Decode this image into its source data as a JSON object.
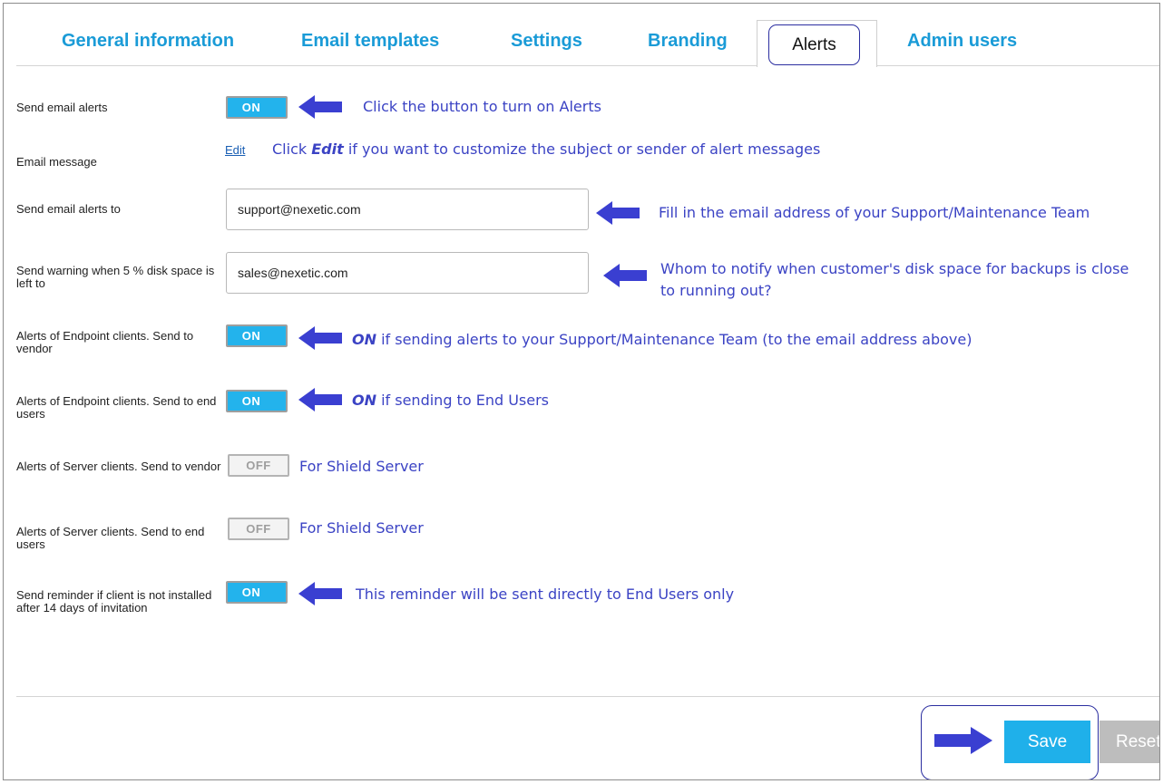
{
  "tabs": [
    {
      "label": "General information"
    },
    {
      "label": "Email templates"
    },
    {
      "label": "Settings"
    },
    {
      "label": "Branding"
    },
    {
      "label": "Alerts",
      "active": true
    },
    {
      "label": "Admin users"
    }
  ],
  "rows": {
    "send_email_alerts": {
      "label": "Send email alerts",
      "toggle": "ON"
    },
    "email_message": {
      "label": "Email message",
      "link": "Edit"
    },
    "send_alerts_to": {
      "label": "Send email alerts to",
      "value": "support@nexetic.com"
    },
    "disk_warning": {
      "label": "Send warning when 5 % disk space is left to",
      "value": "sales@nexetic.com"
    },
    "endpoint_vendor": {
      "label": "Alerts of Endpoint clients. Send to vendor",
      "toggle": "ON"
    },
    "endpoint_users": {
      "label": "Alerts of Endpoint clients. Send to end users",
      "toggle": "ON"
    },
    "server_vendor": {
      "label": "Alerts of Server clients. Send to vendor",
      "toggle": "OFF"
    },
    "server_users": {
      "label": "Alerts of Server clients. Send to end users",
      "toggle": "OFF"
    },
    "reminder": {
      "label": "Send reminder if client is not installed after 14 days of invitation",
      "toggle": "ON"
    }
  },
  "annotations": {
    "turn_on": "Click the button to turn on Alerts",
    "edit_prefix": "Click ",
    "edit_word": "Edit",
    "edit_suffix": " if you want to customize the subject or sender of alert messages",
    "fill_email": "Fill in the email address of your Support/Maintenance Team",
    "whom_line1": "Whom to notify when customer's disk space for backups is close",
    "whom_line2": "to running out?",
    "on_word": "ON",
    "vendor_note": " if sending alerts to your Support/Maintenance Team (to the email address above)",
    "users_note": " if sending to End Users",
    "shield_server_1": "For Shield Server",
    "shield_server_2": "For Shield Server",
    "reminder_note": "This reminder will be sent directly to End Users only"
  },
  "footer": {
    "save": "Save",
    "reset": "Reset"
  },
  "colors": {
    "accent": "#1a9bd7",
    "toggle_on": "#23b3ec",
    "annotation": "#3b43c4",
    "arrow": "#3a3fd1"
  }
}
